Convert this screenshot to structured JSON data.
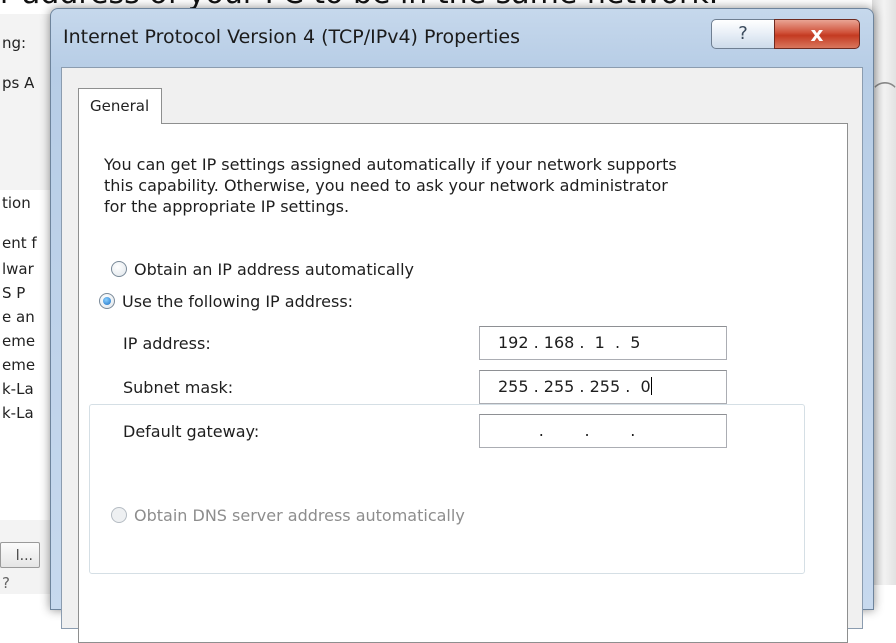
{
  "page_caption": "r address of your PC to be in the same network.",
  "background_window": {
    "labels": [
      "ng:",
      "ps A",
      "tion",
      "ent f",
      "lwar",
      "S P",
      "e an",
      "eme",
      "eme",
      "k-La",
      "k-La"
    ],
    "button_label": "l...",
    "bottom_label": "?"
  },
  "dialog": {
    "title": "Internet Protocol Version 4 (TCP/IPv4) Properties",
    "help_label": "?",
    "close_label": "x",
    "tab_general": "General",
    "description": "You can get IP settings assigned automatically if your network supports\nthis capability. Otherwise, you need to ask your network administrator\nfor the appropriate IP settings.",
    "obtain_ip_auto": "Obtain an IP address automatically",
    "use_following_ip": "Use the following IP address:",
    "ip_label": "IP address:",
    "ip_value": "192 . 168 .  1  .  5",
    "subnet_label": "Subnet mask:",
    "subnet_value": "255 . 255 . 255 .  0",
    "gateway_label": "Default gateway:",
    "gateway_value": "        .        .        .",
    "obtain_dns_auto": "Obtain DNS server address automatically"
  }
}
